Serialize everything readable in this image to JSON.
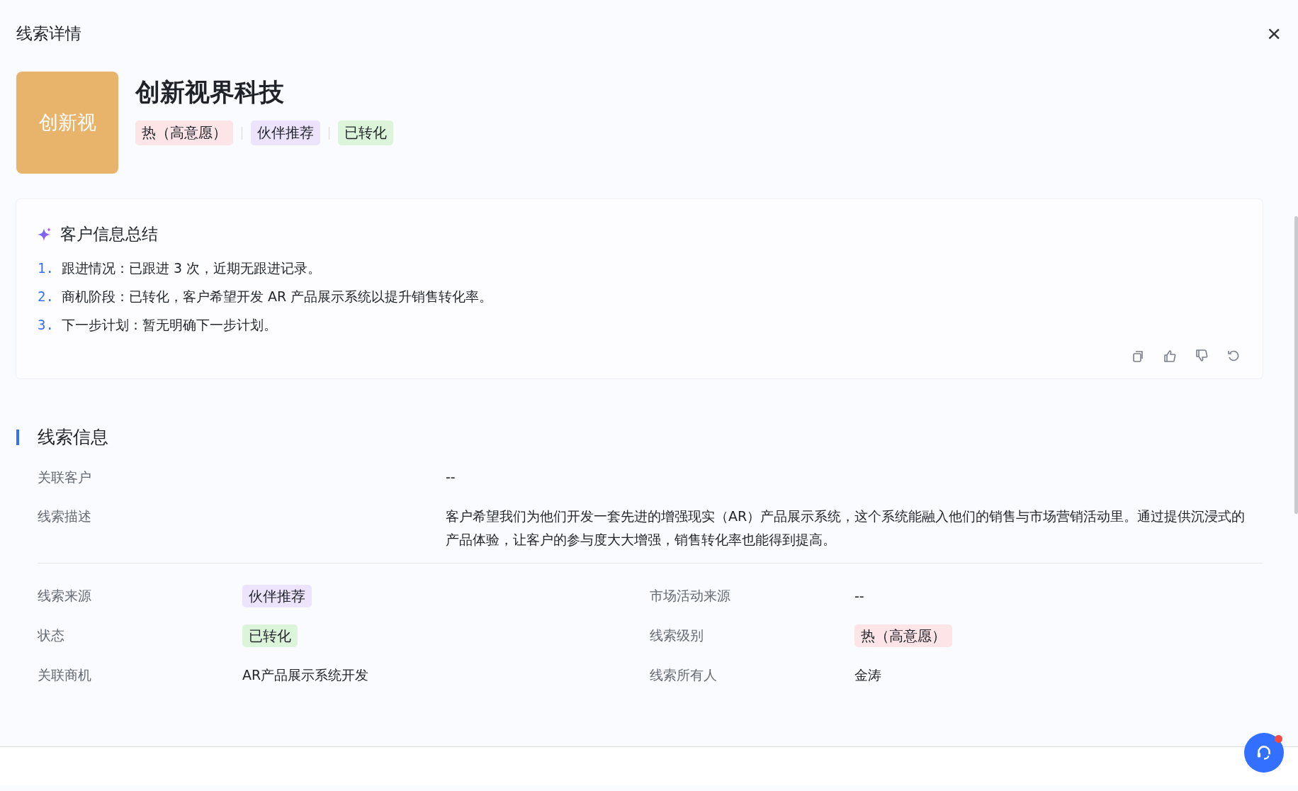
{
  "window": {
    "title": "线索详情",
    "close": "×"
  },
  "lead": {
    "avatar": "创新视",
    "name": "创新视界科技",
    "tags": [
      {
        "text": "热（高意愿）",
        "color": "#fde4e6"
      },
      {
        "text": "伙伴推荐",
        "color": "#ece4fc"
      },
      {
        "text": "已转化",
        "color": "#dcf5da"
      }
    ]
  },
  "summary": {
    "title": "客户信息总结",
    "items": [
      {
        "number": "1.",
        "text": "跟进情况：已跟进 3 次，近期无跟进记录。"
      },
      {
        "number": "2.",
        "text": "商机阶段：已转化，客户希望开发 AR 产品展示系统以提升销售转化率。"
      },
      {
        "number": "3.",
        "text": "下一步计划：暂无明确下一步计划。"
      }
    ],
    "actions": [
      {
        "kind": "copy"
      },
      {
        "kind": "like"
      },
      {
        "kind": "dislike"
      },
      {
        "kind": "regenerate"
      }
    ]
  },
  "lead_info": {
    "title": "线索信息",
    "rows": [
      {
        "label": "关联客户",
        "value": "--"
      },
      {
        "label": "线索描述",
        "value": "客户希望我们为他们开发一套先进的增强现实（AR）产品展示系统，这个系统能融入他们的销售与市场营销活动里。通过提供沉浸式的产品体验，让客户的参与度大大增强，销售转化率也能得到提高。"
      }
    ],
    "fields": [
      {
        "label": "线索来源",
        "kind": "tag",
        "value": "伙伴推荐",
        "color": "#ece4fc"
      },
      {
        "label": "市场活动来源",
        "kind": "text",
        "value": "--"
      },
      {
        "label": "状态",
        "kind": "tag",
        "value": "已转化",
        "color": "#dcf5da"
      },
      {
        "label": "线索级别",
        "kind": "tag",
        "value": "热（高意愿）",
        "color": "#fde4e6"
      },
      {
        "label": "关联商机",
        "kind": "text",
        "value": "AR产品展示系统开发"
      },
      {
        "label": "线索所有人",
        "kind": "text",
        "value": "金涛"
      }
    ]
  },
  "help_button": {
    "unread": true
  }
}
